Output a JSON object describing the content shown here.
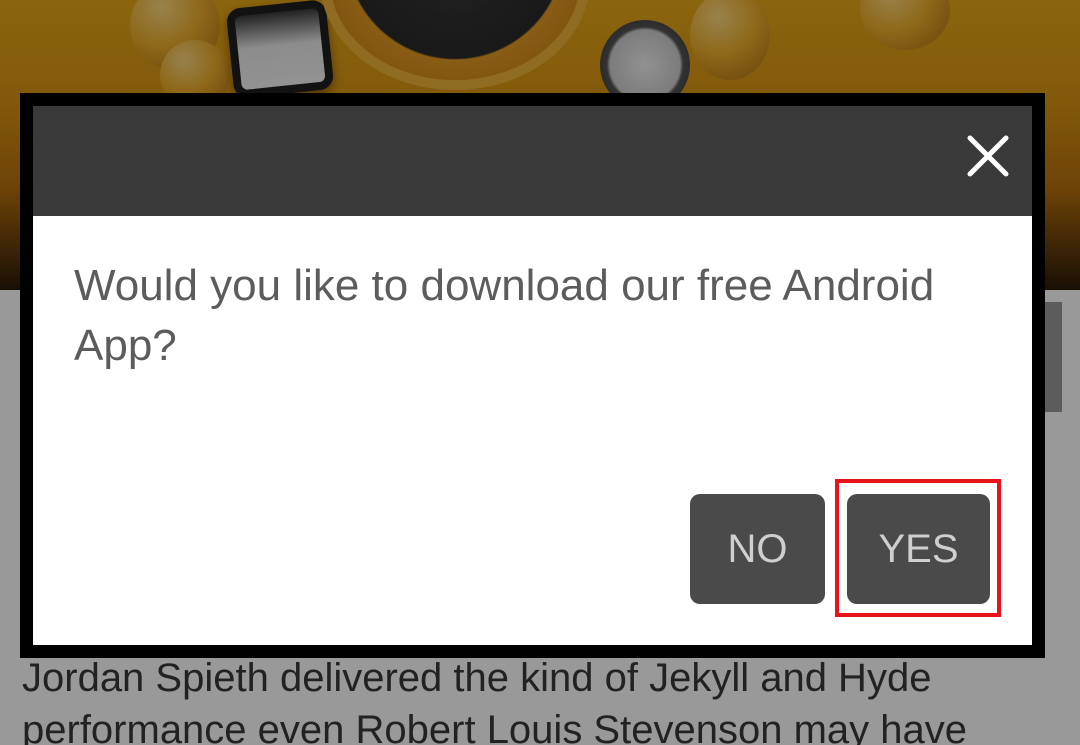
{
  "modal": {
    "message": "Would you like to download our free Android App?",
    "no_label": "NO",
    "yes_label": "YES",
    "close_icon": "close-icon"
  },
  "article": {
    "text": "Jordan Spieth delivered the kind of Jekyll and Hyde performance even Robert Louis Stevenson may have"
  },
  "colors": {
    "modal_header": "#3a3a3a",
    "button_bg": "#4a4a4a",
    "button_text": "#cfcfcf",
    "highlight": "#e8141c",
    "message_text": "#5c5c5c"
  }
}
